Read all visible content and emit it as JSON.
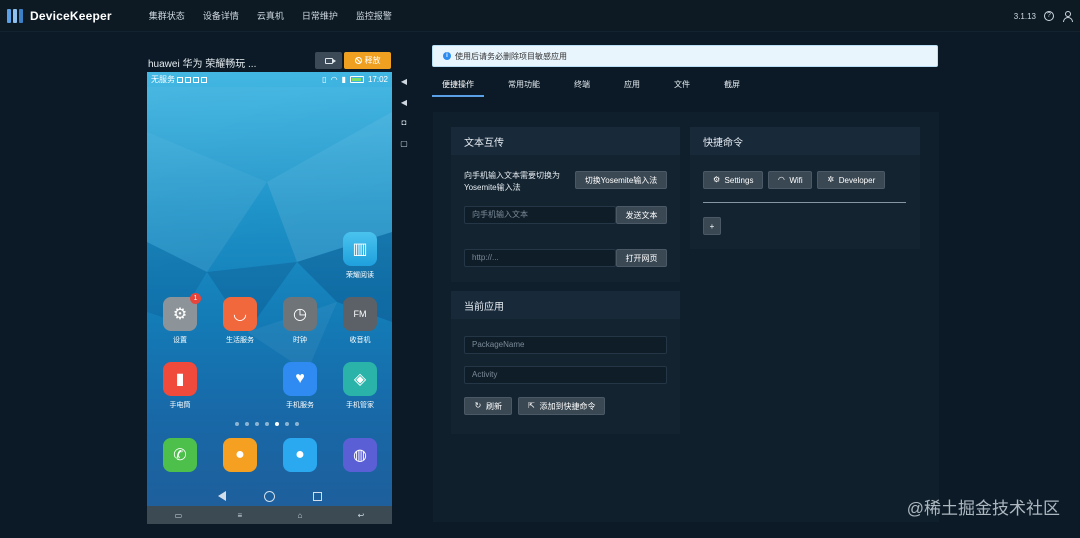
{
  "app": {
    "name": "DeviceKeeper",
    "version": "3.1.13"
  },
  "nav": [
    "集群状态",
    "设备详情",
    "云真机",
    "日常维护",
    "监控报警"
  ],
  "device": {
    "title": "huawei 华为 荣耀畅玩 ...",
    "release_label": "释放",
    "status": {
      "carrier": "无服务",
      "time": "17:02"
    },
    "apps": {
      "honor_read": "荣耀阅读",
      "settings": "设置",
      "settings_badge": "1",
      "life_service": "生活服务",
      "clock": "时钟",
      "radio": "收音机",
      "flashlight": "手电筒",
      "phone_service": "手机服务",
      "phone_manager": "手机管家"
    },
    "page_dots": 6,
    "page_active": 4
  },
  "notice": "使用后请务必删除项目敏感应用",
  "tabs": [
    "便捷操作",
    "常用功能",
    "终端",
    "应用",
    "文件",
    "截屏"
  ],
  "text_transfer": {
    "title": "文本互传",
    "hint": "向手机输入文本需要切换为Yosemite输入法",
    "switch_ime": "切换Yosemite输入法",
    "text_placeholder": "向手机输入文本",
    "send_text": "发送文本",
    "url_placeholder": "http://...",
    "open_url": "打开网页"
  },
  "current_app": {
    "title": "当前应用",
    "package_placeholder": "PackageName",
    "activity_placeholder": "Activity",
    "refresh": "刷新",
    "add_shortcut": "添加到快捷命令"
  },
  "shortcuts": {
    "title": "快捷命令",
    "buttons": [
      "Settings",
      "Wifi",
      "Developer"
    ],
    "add": "+"
  },
  "watermark": "@稀土掘金技术社区",
  "colors": {
    "accent": "#5aa0e6",
    "release": "#f0a020",
    "badge": "#e8443a"
  }
}
